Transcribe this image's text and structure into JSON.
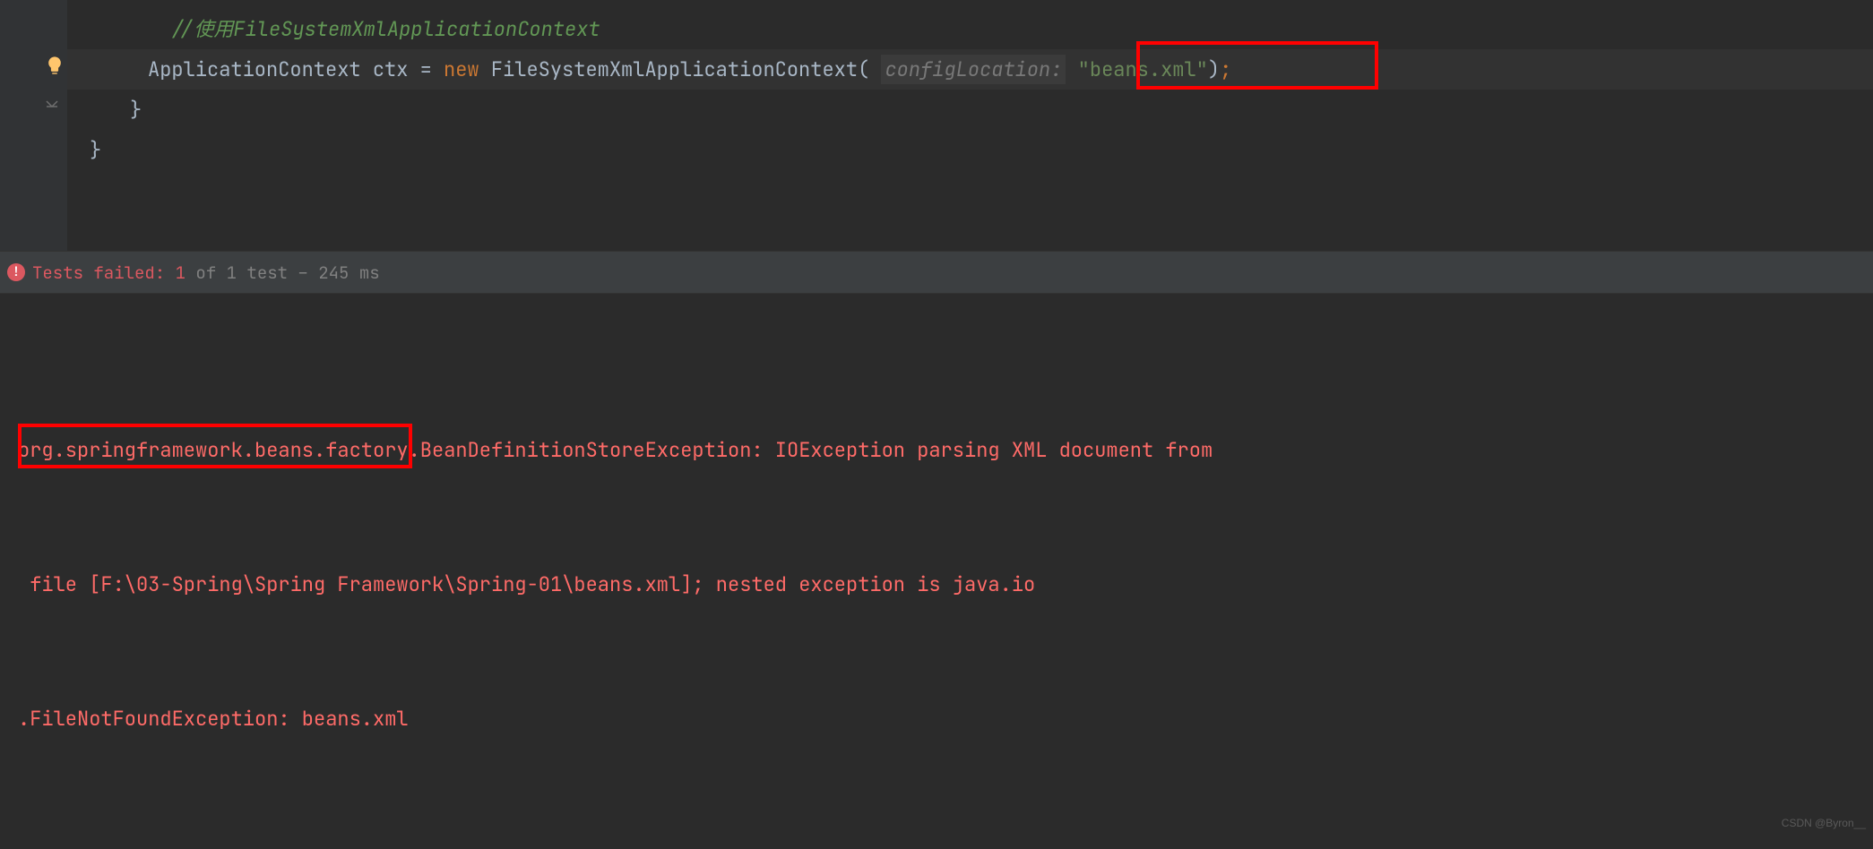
{
  "editor": {
    "comment_line": "//使用FileSystemXmlApplicationContext",
    "code_line": {
      "type": "ApplicationContext",
      "var": "ctx",
      "eq": "=",
      "new_kw": "new",
      "class_name": "FileSystemXmlApplicationContext",
      "paren_open": "(",
      "hint_label": "configLocation:",
      "string_val": "\"beans.xml\"",
      "paren_close": ")",
      "semi": ";"
    },
    "brace1": "}",
    "brace2": "}"
  },
  "status": {
    "prefix": "Tests failed:",
    "failed_count": "1",
    "middle": "of 1 test –",
    "time": "245 ms"
  },
  "console": {
    "line1": "org.springframework.beans.factory.BeanDefinitionStoreException: IOException parsing XML document from",
    "line2": " file [F:\\03-Spring\\Spring Framework\\Spring-01\\beans.xml]; nested exception is java.io",
    "line3": ".FileNotFoundException: beans.xml"
  },
  "watermark": "CSDN @Byron__"
}
